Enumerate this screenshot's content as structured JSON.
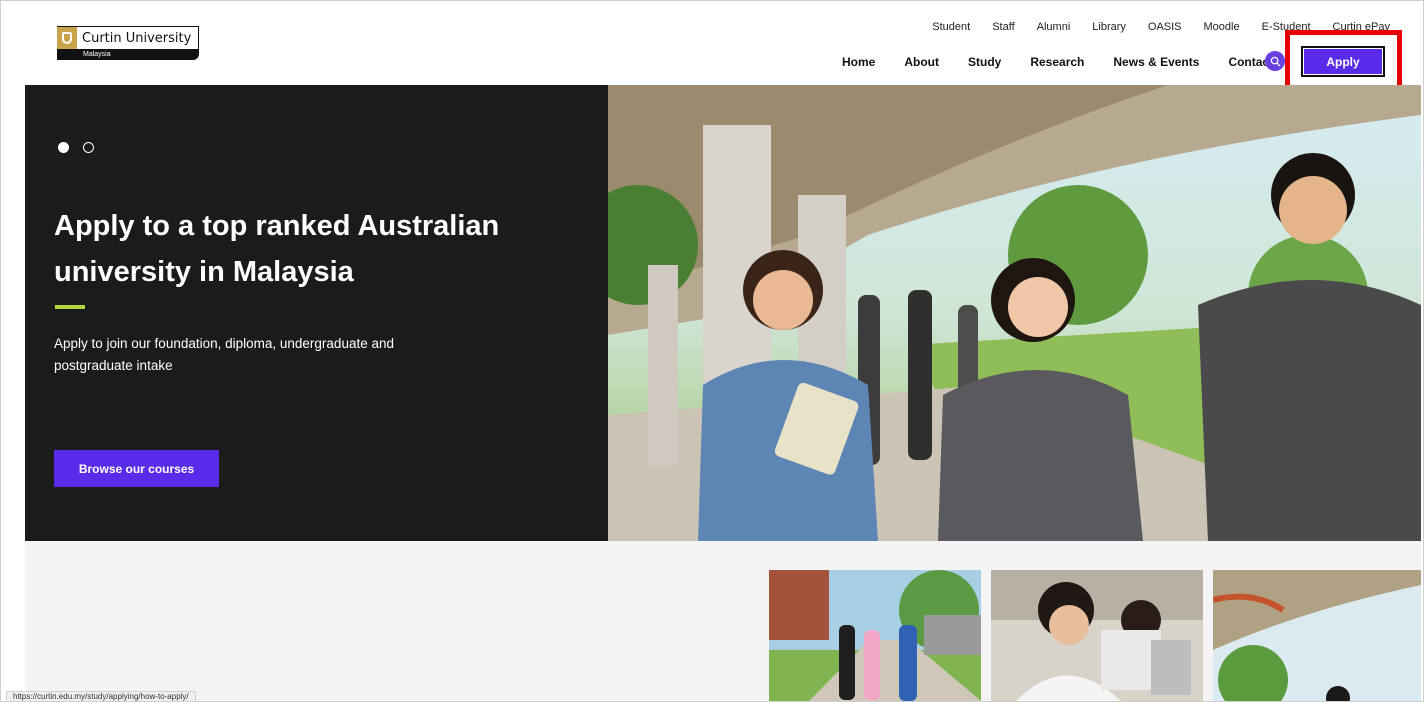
{
  "logo": {
    "name": "Curtin University",
    "sub": "Malaysia"
  },
  "util_nav": [
    "Student",
    "Staff",
    "Alumni",
    "Library",
    "OASIS",
    "Moodle",
    "E-Student",
    "Curtin ePay"
  ],
  "main_nav": [
    "Home",
    "About",
    "Study",
    "Research",
    "News & Events",
    "Contact"
  ],
  "apply_label": "Apply",
  "hero": {
    "title": "Apply to a top ranked Australian university in Malaysia",
    "subtitle": "Apply to join our foundation, diploma, undergraduate and postgraduate intake",
    "cta": "Browse our courses",
    "slides_total": 2,
    "slide_active": 1
  },
  "status_url": "https://curtin.edu.my/study/applying/how-to-apply/",
  "colors": {
    "accent": "#5b2bea",
    "hero_bg": "#1b1b1b",
    "line_accent": "#b4d43c",
    "highlight": "#e60000"
  }
}
